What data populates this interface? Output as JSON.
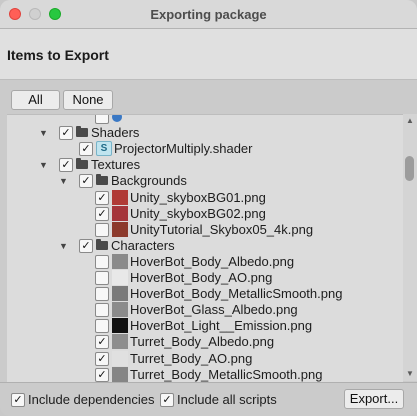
{
  "window": {
    "title": "Exporting package"
  },
  "header": {
    "title": "Items to Export"
  },
  "buttons": {
    "all": "All",
    "none": "None",
    "export": "Export..."
  },
  "footer": {
    "include_dependencies": {
      "label": "Include dependencies",
      "checked": true
    },
    "include_all_scripts": {
      "label": "Include all scripts",
      "checked": true
    }
  },
  "tree": [
    {
      "label": "",
      "indent": 2,
      "type": "file",
      "checked": false,
      "partial": true
    },
    {
      "label": "Shaders",
      "indent": 0,
      "type": "folder",
      "expanded": true,
      "checked": true
    },
    {
      "label": "ProjectorMultiply.shader",
      "indent": 1,
      "type": "shader",
      "checked": true
    },
    {
      "label": "Textures",
      "indent": 0,
      "type": "folder",
      "expanded": true,
      "checked": true
    },
    {
      "label": "Backgrounds",
      "indent": 1,
      "type": "folder",
      "expanded": true,
      "checked": true
    },
    {
      "label": "Unity_skyboxBG01.png",
      "indent": 2,
      "type": "image",
      "thumb": "#b03a36",
      "checked": true
    },
    {
      "label": "Unity_skyboxBG02.png",
      "indent": 2,
      "type": "image",
      "thumb": "#a5353b",
      "checked": true
    },
    {
      "label": "UnityTutorial_Skybox05_4k.png",
      "indent": 2,
      "type": "image",
      "thumb": "#8c3a2c",
      "checked": false
    },
    {
      "label": "Characters",
      "indent": 1,
      "type": "folder",
      "expanded": true,
      "checked": true
    },
    {
      "label": "HoverBot_Body_Albedo.png",
      "indent": 2,
      "type": "image",
      "thumb": "#8a8a8a",
      "checked": false
    },
    {
      "label": "HoverBot_Body_AO.png",
      "indent": 2,
      "type": "image",
      "thumb": "#e8e8e8",
      "checked": false
    },
    {
      "label": "HoverBot_Body_MetallicSmooth.png",
      "indent": 2,
      "type": "image",
      "thumb": "#7a7a7a",
      "checked": false
    },
    {
      "label": "HoverBot_Glass_Albedo.png",
      "indent": 2,
      "type": "image",
      "thumb": "#8b8b8b",
      "checked": false
    },
    {
      "label": "HoverBot_Light__Emission.png",
      "indent": 2,
      "type": "image",
      "thumb": "#111111",
      "checked": false
    },
    {
      "label": "Turret_Body_Albedo.png",
      "indent": 2,
      "type": "image",
      "thumb": "#8e8e8e",
      "checked": true
    },
    {
      "label": "Turret_Body_AO.png",
      "indent": 2,
      "type": "image",
      "thumb": "#e0e0e0",
      "checked": true
    },
    {
      "label": "Turret_Body_MetallicSmooth.png",
      "indent": 2,
      "type": "image",
      "thumb": "#858585",
      "checked": true
    },
    {
      "label": "",
      "indent": 2,
      "type": "image",
      "thumb": "#9a9a9a",
      "checked": true,
      "partial": true
    }
  ]
}
